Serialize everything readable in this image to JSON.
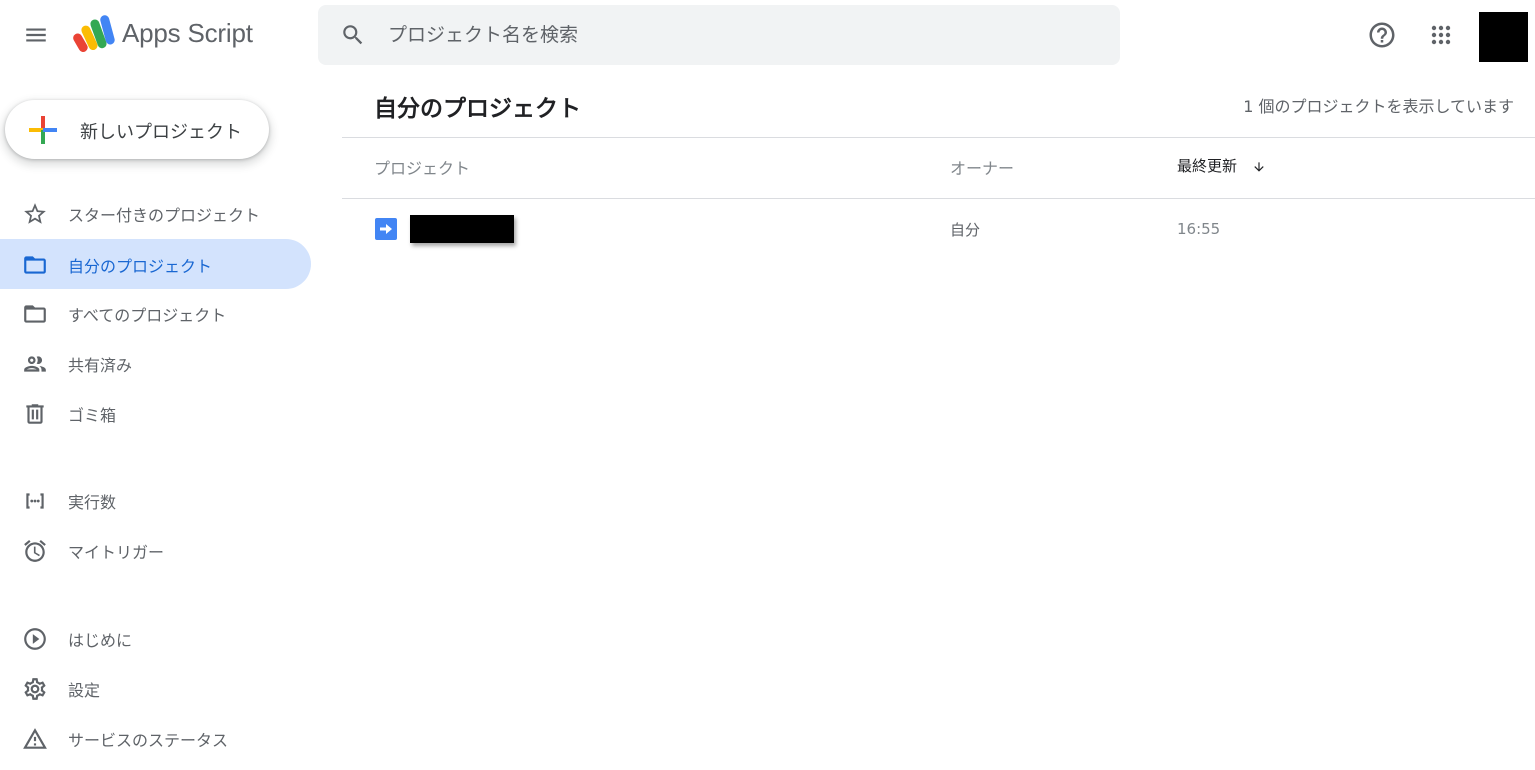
{
  "header": {
    "app_title": "Apps Script",
    "search_placeholder": "プロジェクト名を検索"
  },
  "new_project_label": "新しいプロジェクト",
  "sidebar": {
    "items": [
      {
        "label": "スター付きのプロジェクト",
        "icon": "star-icon",
        "active": false
      },
      {
        "label": "自分のプロジェクト",
        "icon": "folder-icon",
        "active": true
      },
      {
        "label": "すべてのプロジェクト",
        "icon": "folder-icon",
        "active": false
      },
      {
        "label": "共有済み",
        "icon": "people-icon",
        "active": false
      },
      {
        "label": "ゴミ箱",
        "icon": "trash-icon",
        "active": false
      },
      {
        "label": "実行数",
        "icon": "executions-icon",
        "active": false
      },
      {
        "label": "マイトリガー",
        "icon": "alarm-icon",
        "active": false
      },
      {
        "label": "はじめに",
        "icon": "play-circle-icon",
        "active": false
      },
      {
        "label": "設定",
        "icon": "gear-icon",
        "active": false
      },
      {
        "label": "サービスのステータス",
        "icon": "warning-icon",
        "active": false
      }
    ]
  },
  "main": {
    "title": "自分のプロジェクト",
    "count_text": "1 個のプロジェクトを表示しています",
    "columns": {
      "project": "プロジェクト",
      "owner": "オーナー",
      "last_modified": "最終更新"
    },
    "rows": [
      {
        "owner": "自分",
        "modified": "16:55"
      }
    ]
  },
  "colors": {
    "active_bg": "#d3e3fd",
    "active_text": "#1967d2",
    "project_icon": "#4285f4"
  }
}
